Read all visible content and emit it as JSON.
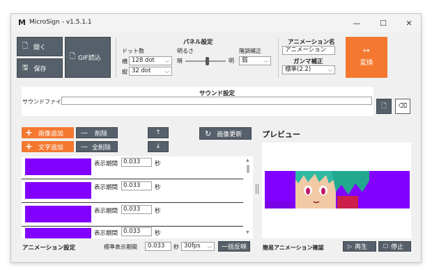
{
  "window": {
    "title": "MicroSign - v1.5.1.1",
    "app_icon": "M"
  },
  "controls": {
    "minimize": "—",
    "maximize": "☐",
    "close": "✕"
  },
  "toolbar": {
    "open": "開く",
    "save": "保存",
    "gif_import": "GIF読込",
    "convert_icon": "↦",
    "convert": "変換"
  },
  "panel": {
    "heading": "パネル設定",
    "dots_label": "ドット数",
    "width_label": "横",
    "width_value": "128 dot",
    "height_label": "縦",
    "height_value": "32 dot",
    "brightness_label": "明るさ",
    "dark_label": "暗",
    "bright_label": "明",
    "brightness_value": 0.55,
    "tone_label": "階調補正",
    "tone_value": "弱"
  },
  "animation": {
    "name_heading": "アニメーション名",
    "name_value": "アニメーション",
    "gamma_heading": "ガンマ補正",
    "gamma_value": "標準(2.2)"
  },
  "sound": {
    "heading": "サウンド設定",
    "file_label": "サウンドファイル",
    "file_value": ""
  },
  "frames": {
    "add_image": "画像追加",
    "add_text": "文字追加",
    "delete": "削除",
    "delete_all": "全削除",
    "refresh": "画像更新",
    "display_label": "表示期間",
    "unit": "秒",
    "items": [
      {
        "duration": "0.033"
      },
      {
        "duration": "0.033"
      },
      {
        "duration": "0.033"
      },
      {
        "duration": "0.033"
      }
    ]
  },
  "footer": {
    "anim_settings": "アニメーション設定",
    "std_duration_label": "標準表示期間",
    "std_duration": "0.033",
    "std_unit": "秒",
    "fps": "30fps",
    "apply_all": "一括反映",
    "preview_check": "簡易アニメーション確認",
    "play": "再生",
    "stop": "停止"
  },
  "preview": {
    "heading": "プレビュー",
    "accent": "#8200ff"
  },
  "colors": {
    "accent": "#f4782f",
    "dark_button": "#56606a",
    "frame_fill": "#8200ff"
  }
}
